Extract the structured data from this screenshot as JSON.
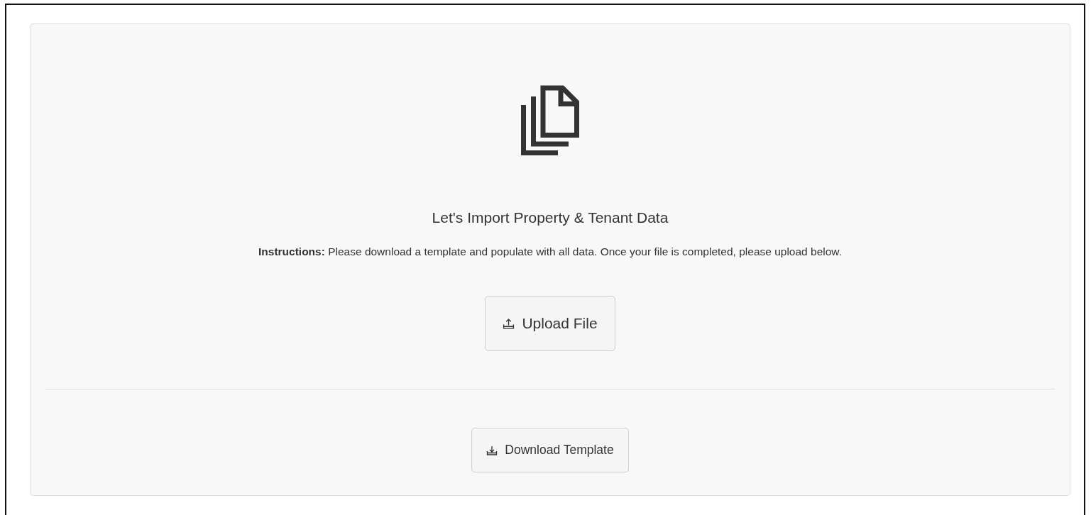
{
  "import_panel": {
    "title": "Let's Import Property & Tenant Data",
    "instructions": "**Instructions:** Please download a template and populate with all data. Once your file is completed, please upload below.",
    "upload_button": {
      "label": "Upload File"
    },
    "download_button": {
      "label": "Download Template"
    }
  }
}
